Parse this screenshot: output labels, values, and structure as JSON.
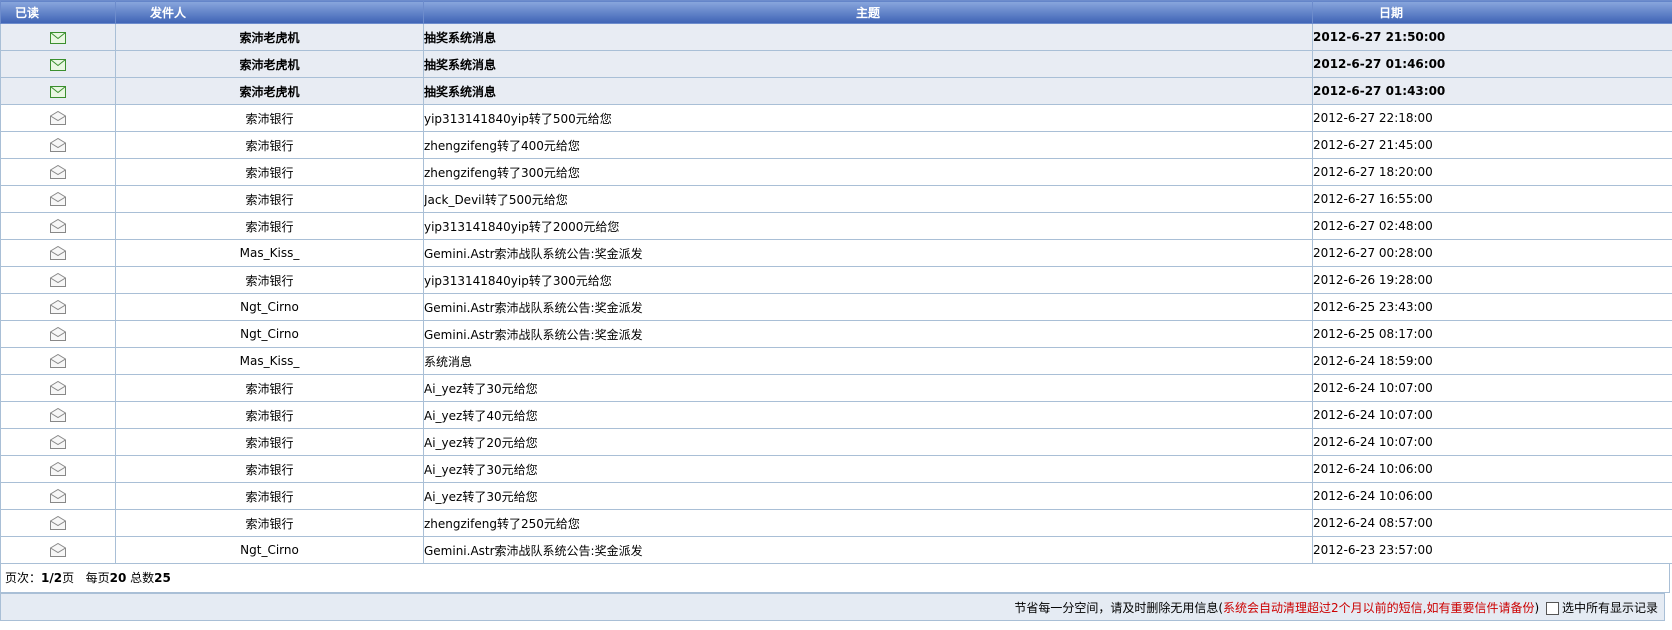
{
  "columns": {
    "read": "已读",
    "sender": "发件人",
    "subject": "主题",
    "date": "日期"
  },
  "rows": [
    {
      "status": "unread",
      "sender": "索沛老虎机",
      "subject": "抽奖系统消息",
      "date": "2012-6-27 21:50:00"
    },
    {
      "status": "unread",
      "sender": "索沛老虎机",
      "subject": "抽奖系统消息",
      "date": "2012-6-27 01:46:00"
    },
    {
      "status": "unread",
      "sender": "索沛老虎机",
      "subject": "抽奖系统消息",
      "date": "2012-6-27 01:43:00"
    },
    {
      "status": "read",
      "sender": "索沛银行",
      "subject": "yip313141840yip转了500元给您",
      "date": "2012-6-27 22:18:00"
    },
    {
      "status": "read",
      "sender": "索沛银行",
      "subject": "zhengzifeng转了400元给您",
      "date": "2012-6-27 21:45:00"
    },
    {
      "status": "read",
      "sender": "索沛银行",
      "subject": "zhengzifeng转了300元给您",
      "date": "2012-6-27 18:20:00"
    },
    {
      "status": "read",
      "sender": "索沛银行",
      "subject": "Jack_Devil转了500元给您",
      "date": "2012-6-27 16:55:00"
    },
    {
      "status": "read",
      "sender": "索沛银行",
      "subject": "yip313141840yip转了2000元给您",
      "date": "2012-6-27 02:48:00"
    },
    {
      "status": "read",
      "sender": "Mas_Kiss_",
      "subject": "Gemini.Astr索沛战队系统公告:奖金派发",
      "date": "2012-6-27 00:28:00"
    },
    {
      "status": "read",
      "sender": "索沛银行",
      "subject": "yip313141840yip转了300元给您",
      "date": "2012-6-26 19:28:00"
    },
    {
      "status": "read",
      "sender": "Ngt_Cirno",
      "subject": "Gemini.Astr索沛战队系统公告:奖金派发",
      "date": "2012-6-25 23:43:00"
    },
    {
      "status": "read",
      "sender": "Ngt_Cirno",
      "subject": "Gemini.Astr索沛战队系统公告:奖金派发",
      "date": "2012-6-25 08:17:00"
    },
    {
      "status": "read",
      "sender": "Mas_Kiss_",
      "subject": "系统消息",
      "date": "2012-6-24 18:59:00"
    },
    {
      "status": "read",
      "sender": "索沛银行",
      "subject": "Ai_yez转了30元给您",
      "date": "2012-6-24 10:07:00"
    },
    {
      "status": "read",
      "sender": "索沛银行",
      "subject": "Ai_yez转了40元给您",
      "date": "2012-6-24 10:07:00"
    },
    {
      "status": "read",
      "sender": "索沛银行",
      "subject": "Ai_yez转了20元给您",
      "date": "2012-6-24 10:07:00"
    },
    {
      "status": "read",
      "sender": "索沛银行",
      "subject": "Ai_yez转了30元给您",
      "date": "2012-6-24 10:06:00"
    },
    {
      "status": "read",
      "sender": "索沛银行",
      "subject": "Ai_yez转了30元给您",
      "date": "2012-6-24 10:06:00"
    },
    {
      "status": "read",
      "sender": "索沛银行",
      "subject": "zhengzifeng转了250元给您",
      "date": "2012-6-24 08:57:00"
    },
    {
      "status": "read",
      "sender": "Ngt_Cirno",
      "subject": "Gemini.Astr索沛战队系统公告:奖金派发",
      "date": "2012-6-23 23:57:00"
    }
  ],
  "pagination": {
    "page_label": "页次：",
    "page_value": "1/2",
    "page_suffix": "页",
    "per_page_label": "每页",
    "per_page_value": "20",
    "total_label": "总数",
    "total_value": "25"
  },
  "footer": {
    "notice": "节省每一分空间，请及时删除无用信息(",
    "warning": "系统会自动清理超过2个月以前的短信,如有重要信件请备份",
    "notice_end": ")",
    "select_all": "选中所有显示记录"
  },
  "colors": {
    "header_top": "#8aa7dd",
    "header_bottom": "#3e63b5",
    "unread_bg": "#e8ecf3",
    "border": "#a9bfd6",
    "warning": "#cc0000"
  },
  "icons": {
    "unread": "envelope-closed-icon",
    "read": "envelope-open-icon"
  }
}
